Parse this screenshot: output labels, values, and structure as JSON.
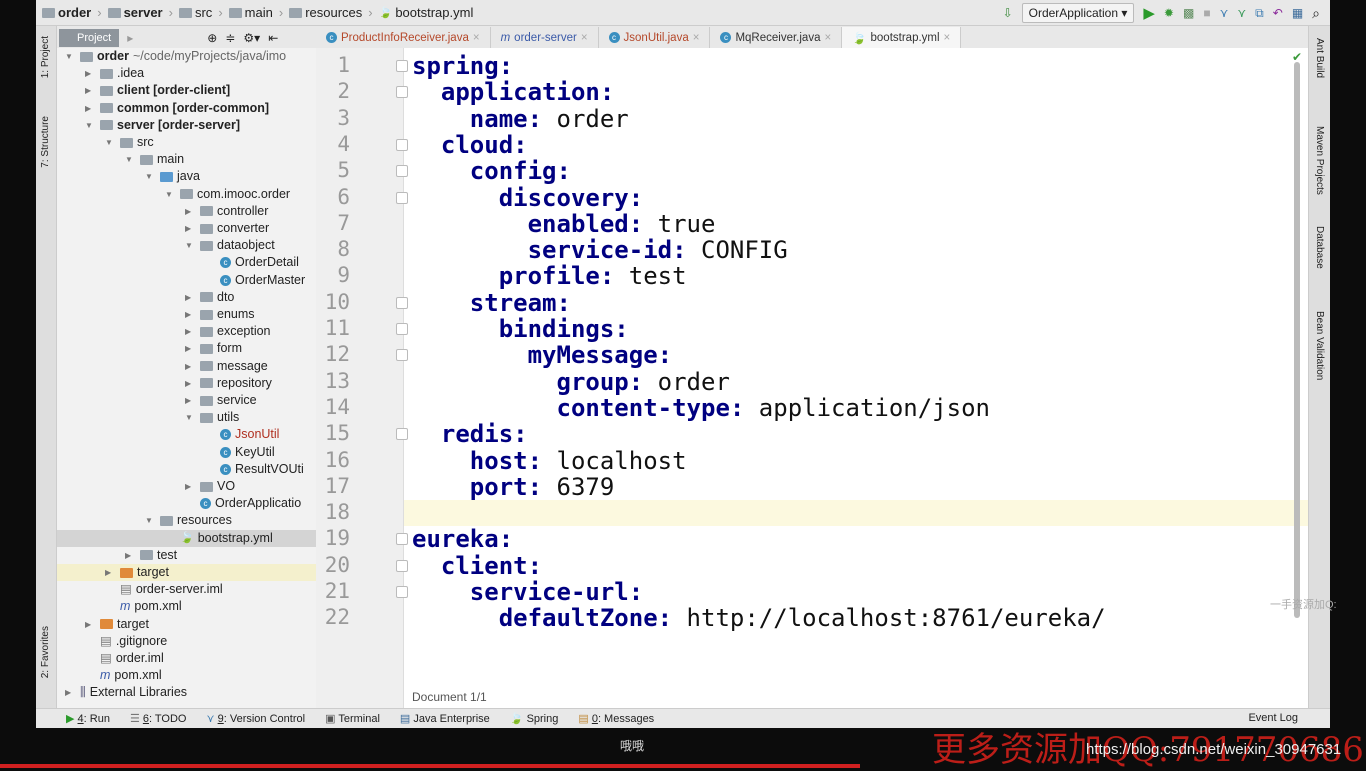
{
  "breadcrumbs": [
    "order",
    "server",
    "src",
    "main",
    "resources",
    "bootstrap.yml"
  ],
  "toolbar": {
    "run_config": "OrderApplication"
  },
  "project_button": "Project",
  "tabs": [
    {
      "label": "ProductInfoReceiver.java",
      "color": "#b5482a"
    },
    {
      "label": "order-server",
      "color": "#3a5aa8"
    },
    {
      "label": "JsonUtil.java",
      "color": "#b5482a"
    },
    {
      "label": "MqReceiver.java",
      "color": "#333"
    },
    {
      "label": "bootstrap.yml",
      "color": "#333",
      "active": true
    }
  ],
  "left_stripe": [
    "1: Project",
    "7: Structure",
    "2: Favorites"
  ],
  "right_stripe": [
    "Ant Build",
    "Maven Projects",
    "Database",
    "Bean Validation"
  ],
  "tree": [
    {
      "t": "order",
      "s": " ~/code/myProjects/java/imo",
      "l": 0,
      "o": 1,
      "b": 1
    },
    {
      "t": ".idea",
      "l": 1,
      "o": 0
    },
    {
      "t": "client [order-client]",
      "l": 1,
      "o": 0,
      "b": 1
    },
    {
      "t": "common [order-common]",
      "l": 1,
      "o": 0,
      "b": 1
    },
    {
      "t": "server [order-server]",
      "l": 1,
      "o": 1,
      "b": 1
    },
    {
      "t": "src",
      "l": 2,
      "o": 1
    },
    {
      "t": "main",
      "l": 3,
      "o": 1
    },
    {
      "t": "java",
      "l": 4,
      "o": 1
    },
    {
      "t": "com.imooc.order",
      "l": 5,
      "o": 1
    },
    {
      "t": "controller",
      "l": 6,
      "o": 0
    },
    {
      "t": "converter",
      "l": 6,
      "o": 0
    },
    {
      "t": "dataobject",
      "l": 6,
      "o": 1
    },
    {
      "t": "OrderDetail",
      "l": 7,
      "c": 1
    },
    {
      "t": "OrderMaster",
      "l": 7,
      "c": 1
    },
    {
      "t": "dto",
      "l": 6,
      "o": 0
    },
    {
      "t": "enums",
      "l": 6,
      "o": 0
    },
    {
      "t": "exception",
      "l": 6,
      "o": 0
    },
    {
      "t": "form",
      "l": 6,
      "o": 0
    },
    {
      "t": "message",
      "l": 6,
      "o": 0
    },
    {
      "t": "repository",
      "l": 6,
      "o": 0
    },
    {
      "t": "service",
      "l": 6,
      "o": 0
    },
    {
      "t": "utils",
      "l": 6,
      "o": 1
    },
    {
      "t": "JsonUtil",
      "l": 7,
      "c": 1,
      "red": 1
    },
    {
      "t": "KeyUtil",
      "l": 7,
      "c": 1
    },
    {
      "t": "ResultVOUti",
      "l": 7,
      "c": 1
    },
    {
      "t": "VO",
      "l": 6,
      "o": 0
    },
    {
      "t": "OrderApplicatio",
      "l": 6,
      "c": 1
    },
    {
      "t": "resources",
      "l": 4,
      "o": 1
    },
    {
      "t": "bootstrap.yml",
      "l": 5,
      "sel": 1,
      "y": 1
    },
    {
      "t": "test",
      "l": 3,
      "o": 0
    },
    {
      "t": "target",
      "l": 2,
      "o": 0,
      "hl": 1,
      "orange": 1
    },
    {
      "t": "order-server.iml",
      "l": 2,
      "f": 1
    },
    {
      "t": "pom.xml",
      "l": 2,
      "m": 1
    },
    {
      "t": "target",
      "l": 1,
      "o": 0,
      "orange": 1
    },
    {
      "t": ".gitignore",
      "l": 1,
      "f": 1
    },
    {
      "t": "order.iml",
      "l": 1,
      "f": 1
    },
    {
      "t": "pom.xml",
      "l": 1,
      "m": 1
    },
    {
      "t": "External Libraries",
      "l": 0,
      "o": 0
    }
  ],
  "code": [
    {
      "i": 0,
      "k": "spring:",
      "v": ""
    },
    {
      "i": 1,
      "k": "application:",
      "v": ""
    },
    {
      "i": 2,
      "k": "name:",
      "v": " order"
    },
    {
      "i": 1,
      "k": "cloud:",
      "v": ""
    },
    {
      "i": 2,
      "k": "config:",
      "v": ""
    },
    {
      "i": 3,
      "k": "discovery:",
      "v": ""
    },
    {
      "i": 4,
      "k": "enabled:",
      "v": " true"
    },
    {
      "i": 4,
      "k": "service-id:",
      "v": " CONFIG"
    },
    {
      "i": 3,
      "k": "profile:",
      "v": " test"
    },
    {
      "i": 2,
      "k": "stream:",
      "v": ""
    },
    {
      "i": 3,
      "k": "bindings:",
      "v": ""
    },
    {
      "i": 4,
      "k": "myMessage:",
      "v": ""
    },
    {
      "i": 5,
      "k": "group:",
      "v": " order"
    },
    {
      "i": 5,
      "k": "content-type:",
      "v": " application/json"
    },
    {
      "i": 1,
      "k": "redis:",
      "v": ""
    },
    {
      "i": 2,
      "k": "host:",
      "v": " localhost"
    },
    {
      "i": 2,
      "k": "port:",
      "v": " 6379"
    },
    {
      "i": 0,
      "k": "",
      "v": ""
    },
    {
      "i": 0,
      "k": "eureka:",
      "v": ""
    },
    {
      "i": 1,
      "k": "client:",
      "v": ""
    },
    {
      "i": 2,
      "k": "service-url:",
      "v": ""
    },
    {
      "i": 3,
      "k": "defaultZone:",
      "v": " http://localhost:8761/eureka/"
    }
  ],
  "editor_footer": "Document 1/1",
  "status": [
    {
      "n": "4",
      "t": ": Run"
    },
    {
      "n": "6",
      "t": ": TODO"
    },
    {
      "n": "9",
      "t": ": Version Control"
    },
    {
      "n": "",
      "t": "Terminal"
    },
    {
      "n": "",
      "t": "Java Enterprise"
    },
    {
      "n": "",
      "t": "Spring"
    },
    {
      "n": "0",
      "t": ": Messages"
    }
  ],
  "event_log": "Event Log",
  "subtitle": "哦哦",
  "side_text": "一手资源加Q:",
  "watermark": "更多资源加QQ:791770686",
  "url": "https://blog.csdn.net/weixin_30947631"
}
